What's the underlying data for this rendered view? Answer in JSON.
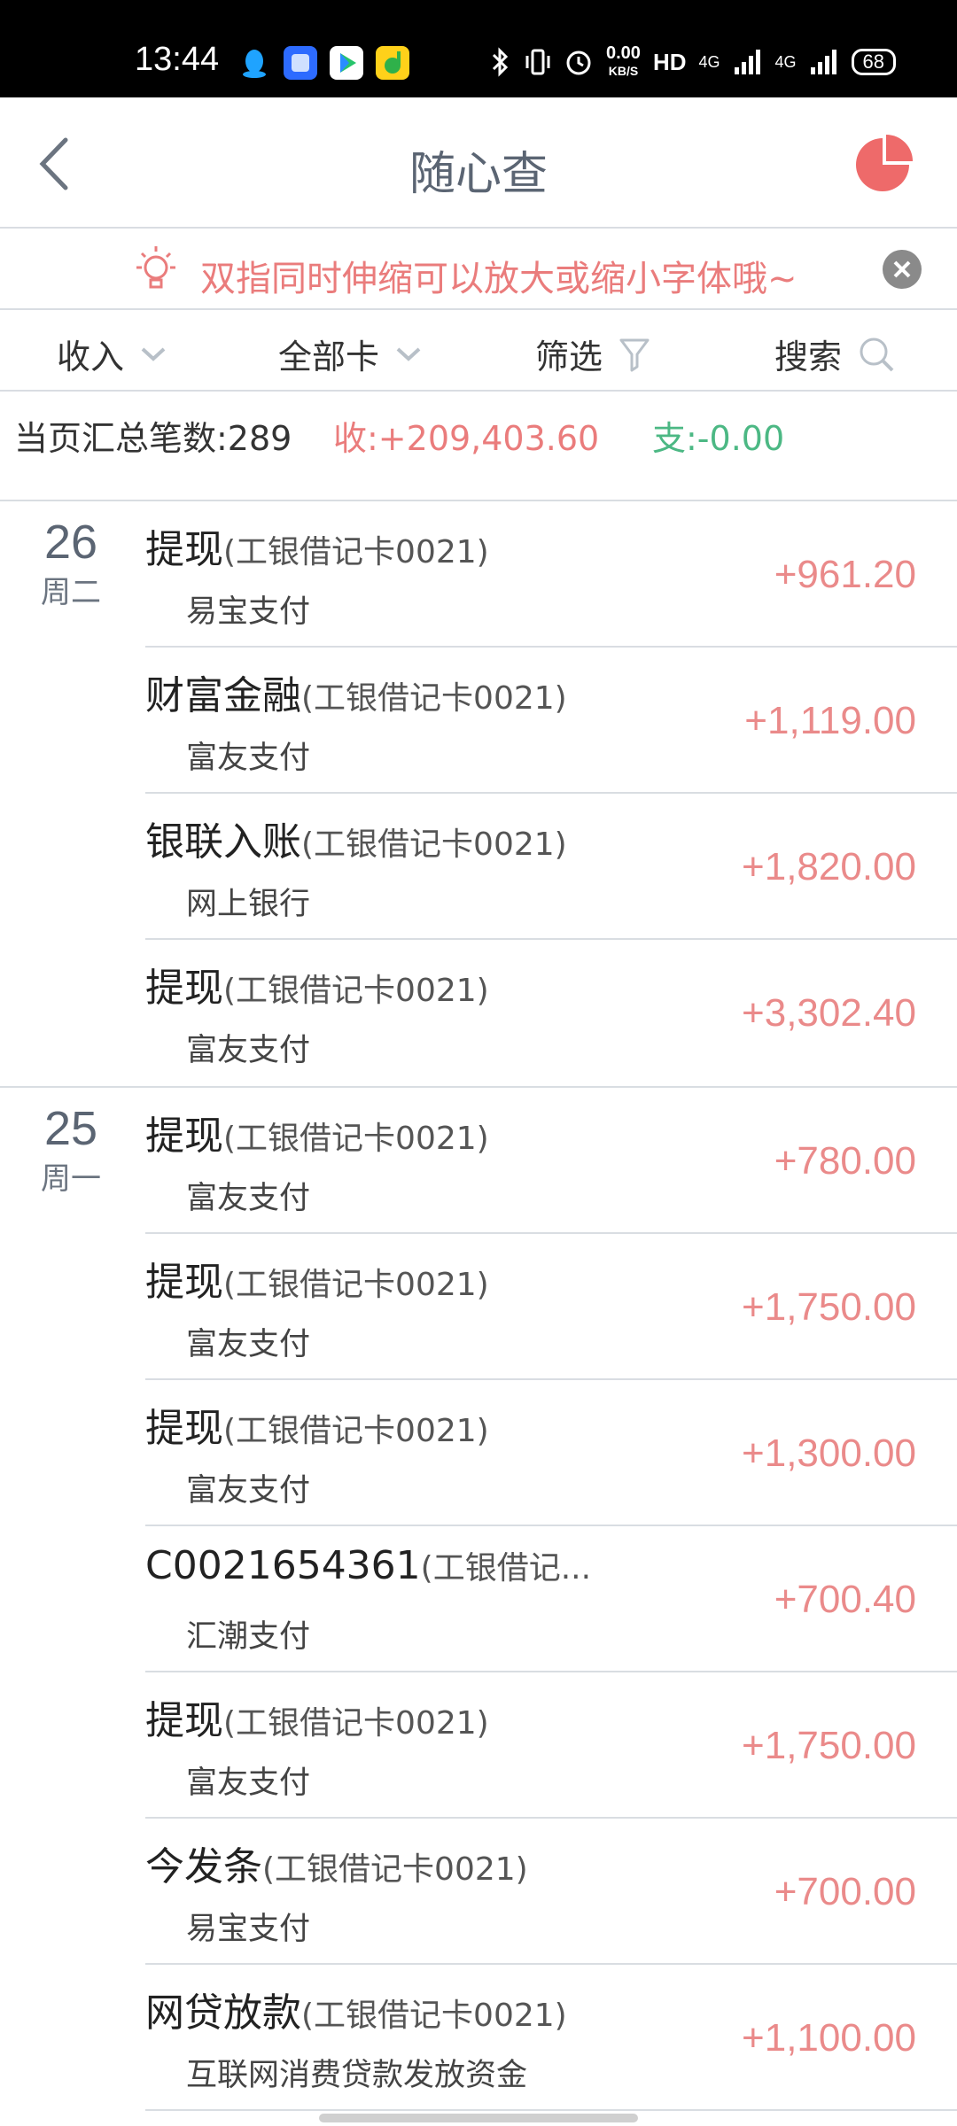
{
  "status_bar": {
    "time": "13:44",
    "speed_top": "0.00",
    "speed_unit": "KB/S",
    "hd": "HD",
    "net1": "4G",
    "net2": "4G",
    "battery": "68"
  },
  "header": {
    "title": "随心查"
  },
  "tip": {
    "text": "双指同时伸缩可以放大或缩小字体哦~"
  },
  "filters": {
    "type_label": "收入",
    "card_label": "全部卡",
    "filter_label": "筛选",
    "search_label": "搜索"
  },
  "summary": {
    "count_text": "当页汇总笔数:289",
    "income_text": "收:+209,403.60",
    "expense_text": "支:-0.00"
  },
  "groups": [
    {
      "day": "26",
      "weekday": "周二",
      "items": [
        {
          "title": "提现",
          "card": "(工银借记卡0021)",
          "sub": "易宝支付",
          "amount": "+961.20"
        },
        {
          "title": "财富金融",
          "card": "(工银借记卡0021)",
          "sub": "富友支付",
          "amount": "+1,119.00"
        },
        {
          "title": "银联入账",
          "card": "(工银借记卡0021)",
          "sub": "网上银行",
          "amount": "+1,820.00"
        },
        {
          "title": "提现",
          "card": "(工银借记卡0021)",
          "sub": "富友支付",
          "amount": "+3,302.40"
        }
      ]
    },
    {
      "day": "25",
      "weekday": "周一",
      "items": [
        {
          "title": "提现",
          "card": "(工银借记卡0021)",
          "sub": "富友支付",
          "amount": "+780.00"
        },
        {
          "title": "提现",
          "card": "(工银借记卡0021)",
          "sub": "富友支付",
          "amount": "+1,750.00"
        },
        {
          "title": "提现",
          "card": "(工银借记卡0021)",
          "sub": "富友支付",
          "amount": "+1,300.00"
        },
        {
          "title": "C0021654361",
          "card": "(工银借记...",
          "sub": "汇潮支付",
          "amount": "+700.40"
        },
        {
          "title": "提现",
          "card": "(工银借记卡0021)",
          "sub": "富友支付",
          "amount": "+1,750.00"
        },
        {
          "title": "今发条",
          "card": "(工银借记卡0021)",
          "sub": "易宝支付",
          "amount": "+700.00"
        },
        {
          "title": "网贷放款",
          "card": "(工银借记卡0021)",
          "sub": "互联网消费贷款发放资金",
          "amount": "+1,100.00"
        }
      ]
    }
  ],
  "colors": {
    "accent_red": "#ea7c7c",
    "accent_green": "#4cb884",
    "divider": "#d9dde2"
  }
}
